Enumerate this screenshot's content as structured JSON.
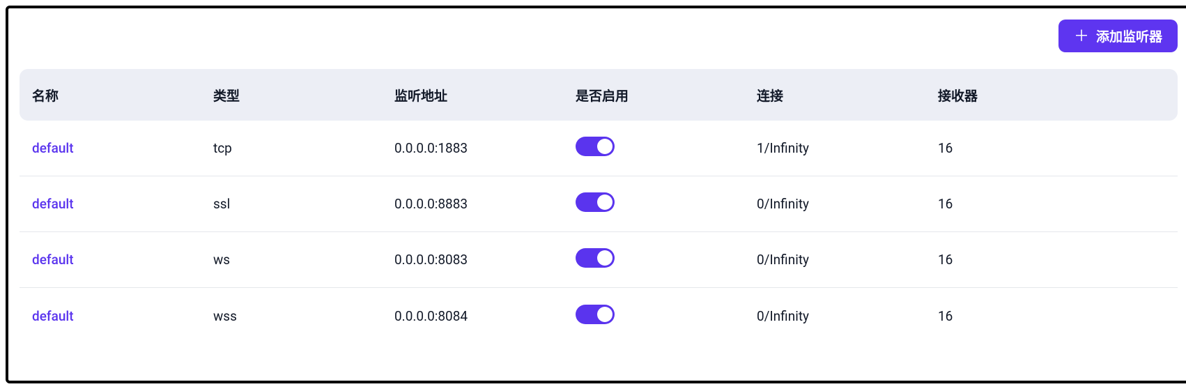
{
  "top": {
    "add_button_label": "添加监听器"
  },
  "table": {
    "headers": {
      "name": "名称",
      "type": "类型",
      "addr": "监听地址",
      "enabled": "是否启用",
      "conn": "连接",
      "acceptors": "接收器"
    },
    "rows": [
      {
        "name": "default",
        "type": "tcp",
        "addr": "0.0.0.0:1883",
        "enabled": true,
        "conn": "1/Infinity",
        "acceptors": "16"
      },
      {
        "name": "default",
        "type": "ssl",
        "addr": "0.0.0.0:8883",
        "enabled": true,
        "conn": "0/Infinity",
        "acceptors": "16"
      },
      {
        "name": "default",
        "type": "ws",
        "addr": "0.0.0.0:8083",
        "enabled": true,
        "conn": "0/Infinity",
        "acceptors": "16"
      },
      {
        "name": "default",
        "type": "wss",
        "addr": "0.0.0.0:8084",
        "enabled": true,
        "conn": "0/Infinity",
        "acceptors": "16"
      }
    ]
  }
}
